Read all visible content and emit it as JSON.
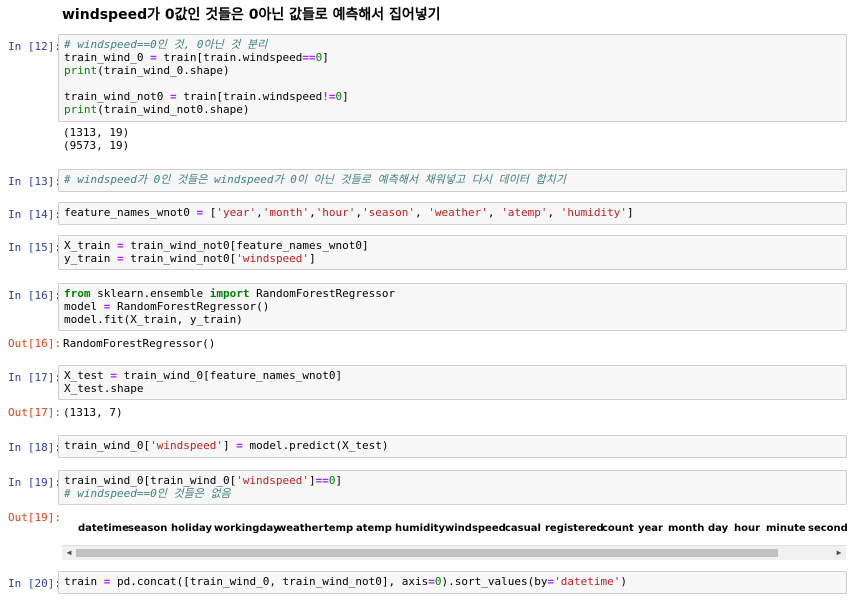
{
  "heading": "windspeed가 0값인 것들은 0아닌 값들로 예측해서 집어넣기",
  "cells": [
    {
      "prompt": "In [12]:",
      "lines": [
        [
          [
            "cm",
            "# windspeed==0인 것, 0아닌 것 분리"
          ]
        ],
        [
          [
            "t",
            "train_wind_0 "
          ],
          [
            "op",
            "="
          ],
          [
            "t",
            " train[train.windspeed"
          ],
          [
            "op",
            "=="
          ],
          [
            "nu",
            "0"
          ],
          [
            "t",
            "]"
          ]
        ],
        [
          [
            "bi",
            "print"
          ],
          [
            "t",
            "(train_wind_0.shape)"
          ]
        ],
        [
          [
            "t",
            ""
          ]
        ],
        [
          [
            "t",
            "train_wind_not0 "
          ],
          [
            "op",
            "="
          ],
          [
            "t",
            " train[train.windspeed"
          ],
          [
            "op",
            "!="
          ],
          [
            "nu",
            "0"
          ],
          [
            "t",
            "]"
          ]
        ],
        [
          [
            "bi",
            "print"
          ],
          [
            "t",
            "(train_wind_not0.shape)"
          ]
        ]
      ]
    },
    {
      "prompt": "In [13]:",
      "lines": [
        [
          [
            "cm",
            "# windspeed가 0인 것들은 windspeed가 0이 아닌 것들로 예측해서 채워넣고 다시 데이터 합치기"
          ]
        ]
      ]
    },
    {
      "prompt": "In [14]:",
      "lines": [
        [
          [
            "t",
            "feature_names_wnot0 "
          ],
          [
            "op",
            "="
          ],
          [
            "t",
            " ["
          ],
          [
            "st",
            "'year'"
          ],
          [
            "t",
            ","
          ],
          [
            "st",
            "'month'"
          ],
          [
            "t",
            ","
          ],
          [
            "st",
            "'hour'"
          ],
          [
            "t",
            ","
          ],
          [
            "st",
            "'season'"
          ],
          [
            "t",
            ", "
          ],
          [
            "st",
            "'weather'"
          ],
          [
            "t",
            ", "
          ],
          [
            "st",
            "'atemp'"
          ],
          [
            "t",
            ", "
          ],
          [
            "st",
            "'humidity'"
          ],
          [
            "t",
            "]"
          ]
        ]
      ]
    },
    {
      "prompt": "In [15]:",
      "lines": [
        [
          [
            "t",
            "X_train "
          ],
          [
            "op",
            "="
          ],
          [
            "t",
            " train_wind_not0[feature_names_wnot0]"
          ]
        ],
        [
          [
            "t",
            "y_train "
          ],
          [
            "op",
            "="
          ],
          [
            "t",
            " train_wind_not0["
          ],
          [
            "st",
            "'windspeed'"
          ],
          [
            "t",
            "]"
          ]
        ]
      ]
    },
    {
      "prompt": "In [16]:",
      "lines": [
        [
          [
            "kw",
            "from"
          ],
          [
            "t",
            " sklearn.ensemble "
          ],
          [
            "kw",
            "import"
          ],
          [
            "t",
            " RandomForestRegressor"
          ]
        ],
        [
          [
            "t",
            "model "
          ],
          [
            "op",
            "="
          ],
          [
            "t",
            " RandomForestRegressor()"
          ]
        ],
        [
          [
            "t",
            "model.fit(X_train, y_train)"
          ]
        ]
      ]
    },
    {
      "prompt": "In [17]:",
      "lines": [
        [
          [
            "t",
            "X_test "
          ],
          [
            "op",
            "="
          ],
          [
            "t",
            " train_wind_0[feature_names_wnot0]"
          ]
        ],
        [
          [
            "t",
            "X_test.shape"
          ]
        ]
      ]
    },
    {
      "prompt": "In [18]:",
      "lines": [
        [
          [
            "t",
            "train_wind_0["
          ],
          [
            "st",
            "'windspeed'"
          ],
          [
            "t",
            "] "
          ],
          [
            "op",
            "="
          ],
          [
            "t",
            " model.predict(X_test)"
          ]
        ]
      ]
    },
    {
      "prompt": "In [19]:",
      "lines": [
        [
          [
            "t",
            "train_wind_0[train_wind_0["
          ],
          [
            "st",
            "'windspeed'"
          ],
          [
            "t",
            "]"
          ],
          [
            "op",
            "=="
          ],
          [
            "nu",
            "0"
          ],
          [
            "t",
            "]"
          ]
        ],
        [
          [
            "cm",
            "# windspeed==0인 것들은 없음"
          ]
        ]
      ]
    },
    {
      "prompt": "In [20]:",
      "lines": [
        [
          [
            "t",
            "train "
          ],
          [
            "op",
            "="
          ],
          [
            "t",
            " pd.concat([train_wind_0, train_wind_not0], axis"
          ],
          [
            "op",
            "="
          ],
          [
            "nu",
            "0"
          ],
          [
            "t",
            ").sort_values(by"
          ],
          [
            "op",
            "="
          ],
          [
            "st",
            "'datetime'"
          ],
          [
            "t",
            ")"
          ]
        ]
      ]
    }
  ],
  "outputs": [
    {
      "prompt": "",
      "text": "(1313, 19)\n(9573, 19)"
    },
    {
      "prompt": "Out[16]:",
      "text": "RandomForestRegressor()"
    },
    {
      "prompt": "Out[17]:",
      "text": "(1313, 7)"
    },
    {
      "prompt": "Out[19]:",
      "text": ""
    }
  ],
  "dataframe_columns": [
    "datetime",
    "season",
    "holiday",
    "workingday",
    "weather",
    "temp",
    "atemp",
    "humidity",
    "windspeed",
    "casual",
    "registered",
    "count",
    "year",
    "month",
    "day",
    "hour",
    "minute",
    "second"
  ],
  "scrollbar": {
    "left_arrow": "◀",
    "right_arrow": "▶"
  }
}
